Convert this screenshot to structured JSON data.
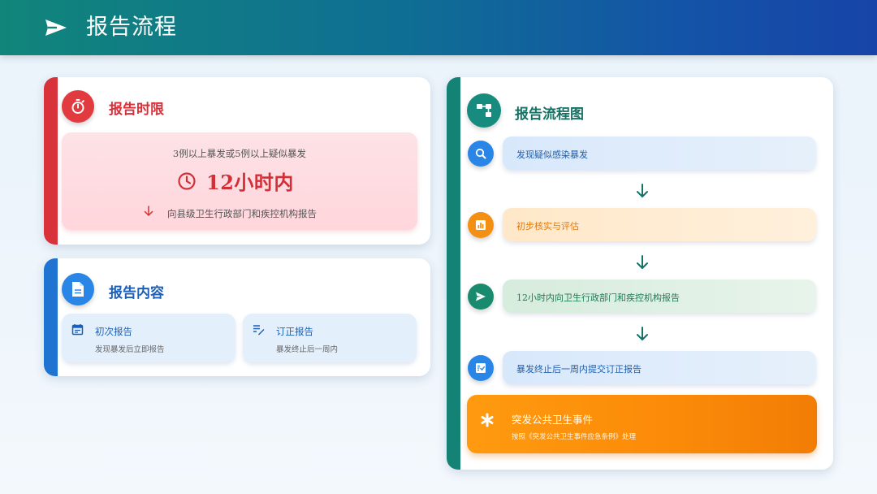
{
  "header": {
    "title": "报告流程",
    "icon": "paper-plane-icon"
  },
  "time_limit": {
    "title": "报告时限",
    "icon": "stopwatch-icon",
    "condition": "3例以上暴发或5例以上疑似暴发",
    "deadline": "12小时内",
    "report_to": "向县级卫生行政部门和疾控机构报告",
    "accent": "#d8323a"
  },
  "content": {
    "title": "报告内容",
    "icon": "document-icon",
    "accent": "#1e74d0",
    "items": [
      {
        "title": "初次报告",
        "desc": "发现暴发后立即报告",
        "icon": "calendar-icon"
      },
      {
        "title": "订正报告",
        "desc": "暴发终止后一周内",
        "icon": "edit-list-icon"
      }
    ]
  },
  "flow": {
    "title": "报告流程图",
    "icon": "flowchart-icon",
    "accent": "#148275",
    "steps": [
      {
        "label": "发现疑似感染暴发",
        "icon": "search-icon",
        "color": "#2a86e6"
      },
      {
        "label": "初步核实与评估",
        "icon": "bar-chart-icon",
        "color": "#f39013"
      },
      {
        "label": "12小时内向卫生行政部门和疾控机构报告",
        "icon": "send-icon",
        "color": "#1a8a6e"
      },
      {
        "label": "暴发终止后一周内提交订正报告",
        "icon": "checklist-icon",
        "color": "#2a86e6"
      }
    ],
    "emergency": {
      "title": "突发公共卫生事件",
      "desc": "按照《突发公共卫生事件应急条例》处理",
      "icon": "asterisk-icon",
      "color": "#fb8a08"
    }
  }
}
